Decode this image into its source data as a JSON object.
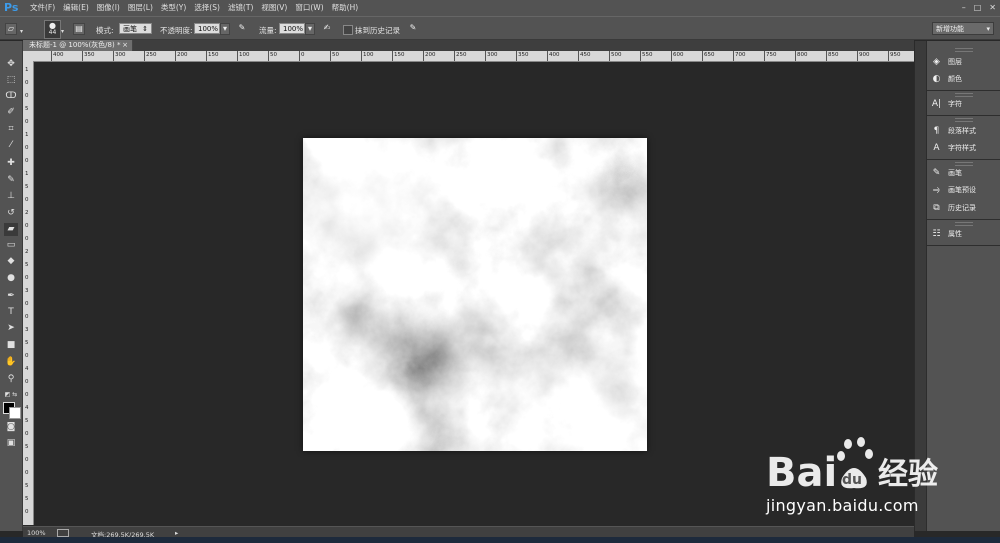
{
  "app": {
    "logo": "Ps"
  },
  "menu": [
    "文件(F)",
    "编辑(E)",
    "图像(I)",
    "图层(L)",
    "类型(Y)",
    "选择(S)",
    "滤镜(T)",
    "视图(V)",
    "窗口(W)",
    "帮助(H)"
  ],
  "options": {
    "brush_size": "44",
    "mode_label": "模式:",
    "mode_value": "画笔",
    "opacity_label": "不透明度:",
    "opacity_value": "100%",
    "flow_label": "流量:",
    "flow_value": "100%",
    "erase_history_label": "抹到历史记录",
    "workspace": "新增功能"
  },
  "document": {
    "tab_title": "未标题-1 @ 100%(灰色/8) *"
  },
  "ruler": {
    "h_ticks": [
      "400",
      "350",
      "300",
      "250",
      "200",
      "150",
      "100",
      "50",
      "0",
      "50",
      "100",
      "150",
      "200",
      "250",
      "300",
      "350",
      "400",
      "450",
      "500",
      "550",
      "600",
      "650",
      "700",
      "750",
      "800",
      "850",
      "900",
      "950"
    ],
    "v_ticks": [
      "1",
      "0",
      "0",
      "5",
      "0",
      "1",
      "0",
      "0",
      "1",
      "5",
      "0",
      "2",
      "0",
      "0",
      "2",
      "5",
      "0",
      "3",
      "0",
      "0",
      "3",
      "5",
      "0",
      "4",
      "0",
      "0",
      "4",
      "5",
      "0",
      "5",
      "0",
      "0",
      "5",
      "5",
      "0"
    ]
  },
  "status": {
    "zoom": "100%",
    "doc_info": "文档:269.5K/269.5K"
  },
  "panels": [
    {
      "icon": "layers-icon",
      "label": "图层"
    },
    {
      "icon": "color-icon",
      "label": "颜色"
    },
    {
      "icon": "character-icon",
      "label": "字符"
    },
    {
      "icon": "paragraph-style-icon",
      "label": "段落样式"
    },
    {
      "icon": "character-style-icon",
      "label": "字符样式"
    },
    {
      "icon": "brush-icon",
      "label": "画笔"
    },
    {
      "icon": "brush-preset-icon",
      "label": "画笔预设"
    },
    {
      "icon": "history-icon",
      "label": "历史记录"
    },
    {
      "icon": "properties-icon",
      "label": "属性"
    }
  ],
  "tools": [
    "move-tool-icon",
    "marquee-tool-icon",
    "lasso-tool-icon",
    "quick-select-tool-icon",
    "crop-tool-icon",
    "eyedropper-tool-icon",
    "spot-healing-tool-icon",
    "brush-tool-icon",
    "clone-stamp-tool-icon",
    "history-brush-tool-icon",
    "eraser-tool-icon",
    "gradient-tool-icon",
    "blur-tool-icon",
    "dodge-tool-icon",
    "pen-tool-icon",
    "type-tool-icon",
    "path-select-tool-icon",
    "rectangle-tool-icon",
    "hand-tool-icon",
    "zoom-tool-icon"
  ],
  "watermark": {
    "brand": "Bai 经验",
    "url": "jingyan.baidu.com"
  }
}
